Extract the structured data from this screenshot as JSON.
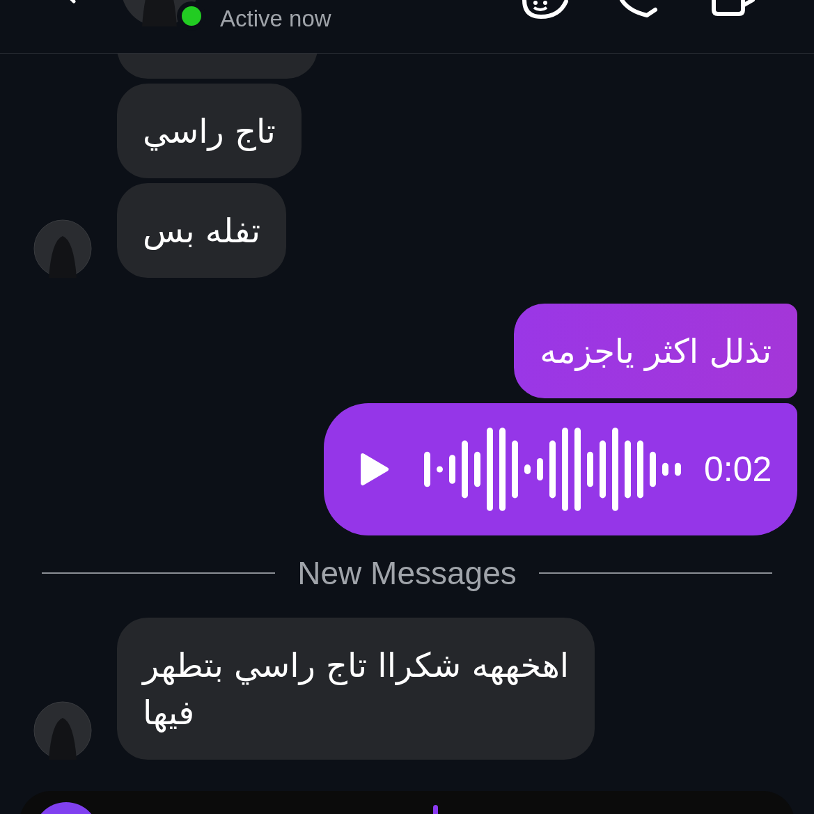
{
  "header": {
    "status": "Active now",
    "online": true
  },
  "messages": [
    {
      "kind": "cut"
    },
    {
      "kind": "incoming",
      "text": "تاج راسي",
      "avatar": false
    },
    {
      "kind": "incoming",
      "text": "تفله بس",
      "avatar": true
    },
    {
      "kind": "outgoing",
      "text": "تذلل اكثر ياجزمه"
    },
    {
      "kind": "voice",
      "duration": "0:02"
    },
    {
      "kind": "divider",
      "text": "New Messages"
    },
    {
      "kind": "incoming",
      "lines": [
        "اهخههه شكراا تاج راسي بتطهر",
        "فيها"
      ],
      "avatar": true
    }
  ]
}
